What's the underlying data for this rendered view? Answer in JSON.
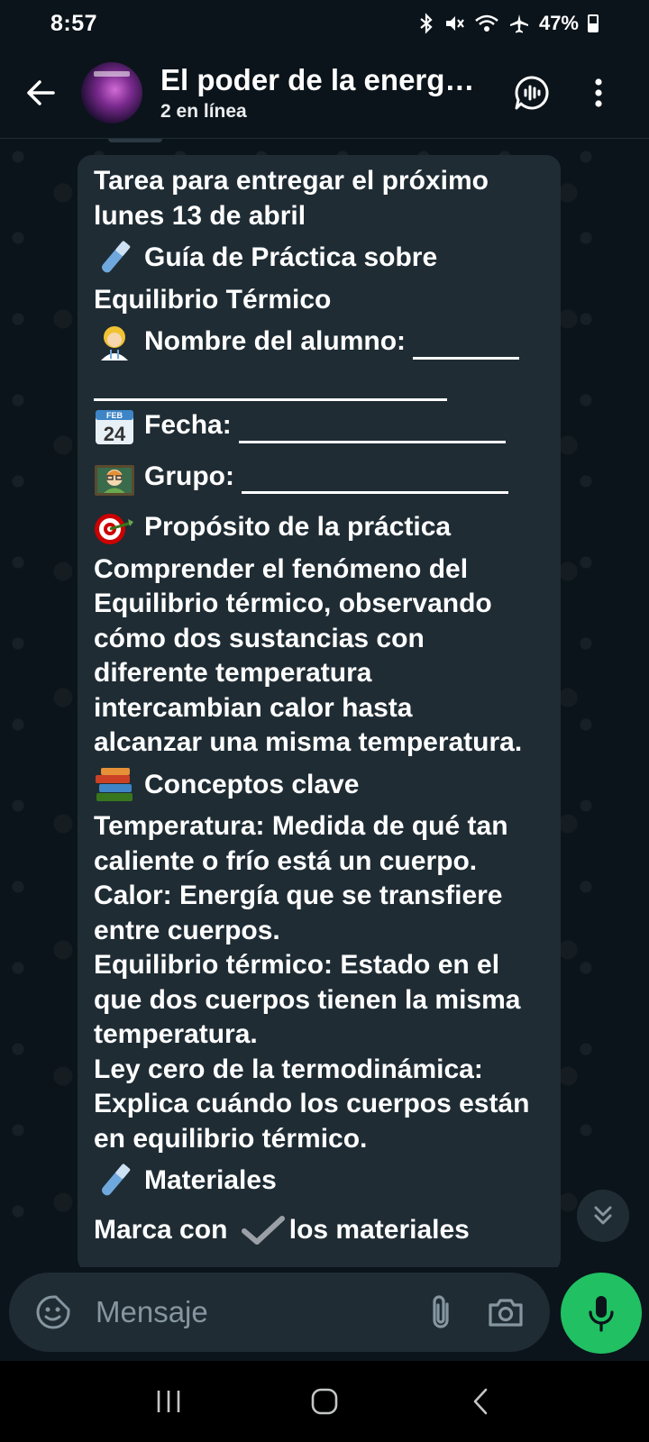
{
  "status_bar": {
    "time": "8:57",
    "battery": "47%",
    "battery_level": 0.47
  },
  "header": {
    "title": "El poder de la energi…",
    "subtitle": "2 en línea"
  },
  "message": {
    "lines": [
      "Tarea para entregar el próximo",
      "lunes 13 de abril",
      "Guía de Práctica sobre",
      "Equilibrio Térmico",
      "Nombre del alumno:",
      "Fecha:",
      "Grupo:",
      "Propósito de la práctica",
      "Comprender el fenómeno del",
      "Equilibrio térmico, observando",
      "cómo dos sustancias con",
      "diferente temperatura",
      "intercambian calor hasta",
      "alcanzar una misma temperatura.",
      "Conceptos clave",
      "Temperatura: Medida de qué tan",
      "caliente o frío está un cuerpo.",
      "Calor: Energía que se transfiere",
      "entre cuerpos.",
      "Equilibrio térmico: Estado en el",
      "que dos cuerpos tienen la misma",
      "temperatura.",
      "Ley cero de la termodinámica:",
      "Explica cuándo los cuerpos están",
      "en equilibrio térmico.",
      "Materiales",
      "Marca con",
      "los materiales"
    ],
    "calendar_emoji": {
      "month": "FEB",
      "day": "24"
    }
  },
  "composer": {
    "placeholder": "Mensaje"
  },
  "colors": {
    "background": "#0b141a",
    "bubble": "#1f2c34",
    "accent": "#21c063",
    "input": "#1f2c33"
  }
}
